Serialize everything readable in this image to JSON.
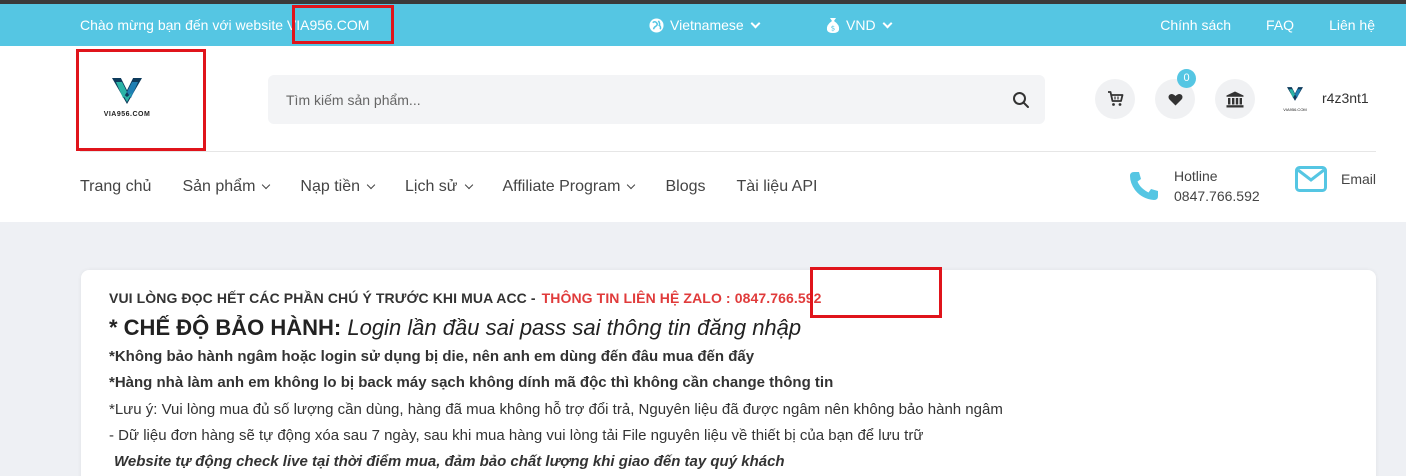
{
  "topbar": {
    "welcome": "Chào mừng bạn đến với website ",
    "site": "VIA956.COM",
    "language": "Vietnamese",
    "currency": "VND",
    "links": [
      "Chính sách",
      "FAQ",
      "Liên hệ"
    ]
  },
  "header": {
    "logo_text": "VIA956.COM",
    "search_placeholder": "Tìm kiếm sản phẩm...",
    "wishlist_count": "0",
    "username": "r4z3nt1"
  },
  "nav": {
    "items": [
      "Trang chủ",
      "Sản phẩm",
      "Nạp tiền",
      "Lịch sử",
      "Affiliate Program",
      "Blogs",
      "Tài liệu API"
    ]
  },
  "contact": {
    "hotline_label": "Hotline",
    "hotline_number": "0847.766.592",
    "email_label": "Email"
  },
  "notice": {
    "intro": "VUI LÒNG ĐỌC HẾT CÁC PHẦN CHÚ Ý TRƯỚC KHI MUA ACC -",
    "zalo_label": "THÔNG TIN LIÊN HỆ ZALO :",
    "zalo_number": "0847.766.592",
    "heading_bold": "* CHẾ ĐỘ BẢO HÀNH:",
    "heading_italic": " Login lần đầu sai pass sai thông tin đăng nhập",
    "line1": "*Không bảo hành ngâm hoặc login sử dụng bị die,  nên anh em dùng đến đâu mua đến đấy",
    "line2": "*Hàng nhà làm anh em không lo bị back máy sạch không dính mã độc thì không cần change thông tin",
    "line3": "*Lưu ý: Vui lòng mua đủ số lượng cần dùng, hàng đã mua không hỗ trợ đổi trả, Nguyên liệu đã được ngâm nên không bảo hành ngâm",
    "line4": "- Dữ liệu đơn hàng sẽ tự động xóa sau 7 ngày, sau khi mua hàng vui lòng tải File nguyên liệu về thiết bị của bạn để lưu trữ",
    "line5": "Website tự động check live tại thời điểm mua, đảm bảo chất lượng khi giao đến tay quý khách"
  },
  "colors": {
    "topbar_bg": "#55c6e3",
    "accent": "#55c6e3",
    "highlight_red": "#e0141b",
    "zalo_red": "#e03b3b",
    "page_bg": "#eef0f4"
  },
  "icons": [
    "globe-icon",
    "money-bag-icon",
    "search-icon",
    "cart-icon",
    "heart-icon",
    "bank-icon",
    "phone-icon",
    "mail-icon",
    "chevron-down-icon"
  ]
}
